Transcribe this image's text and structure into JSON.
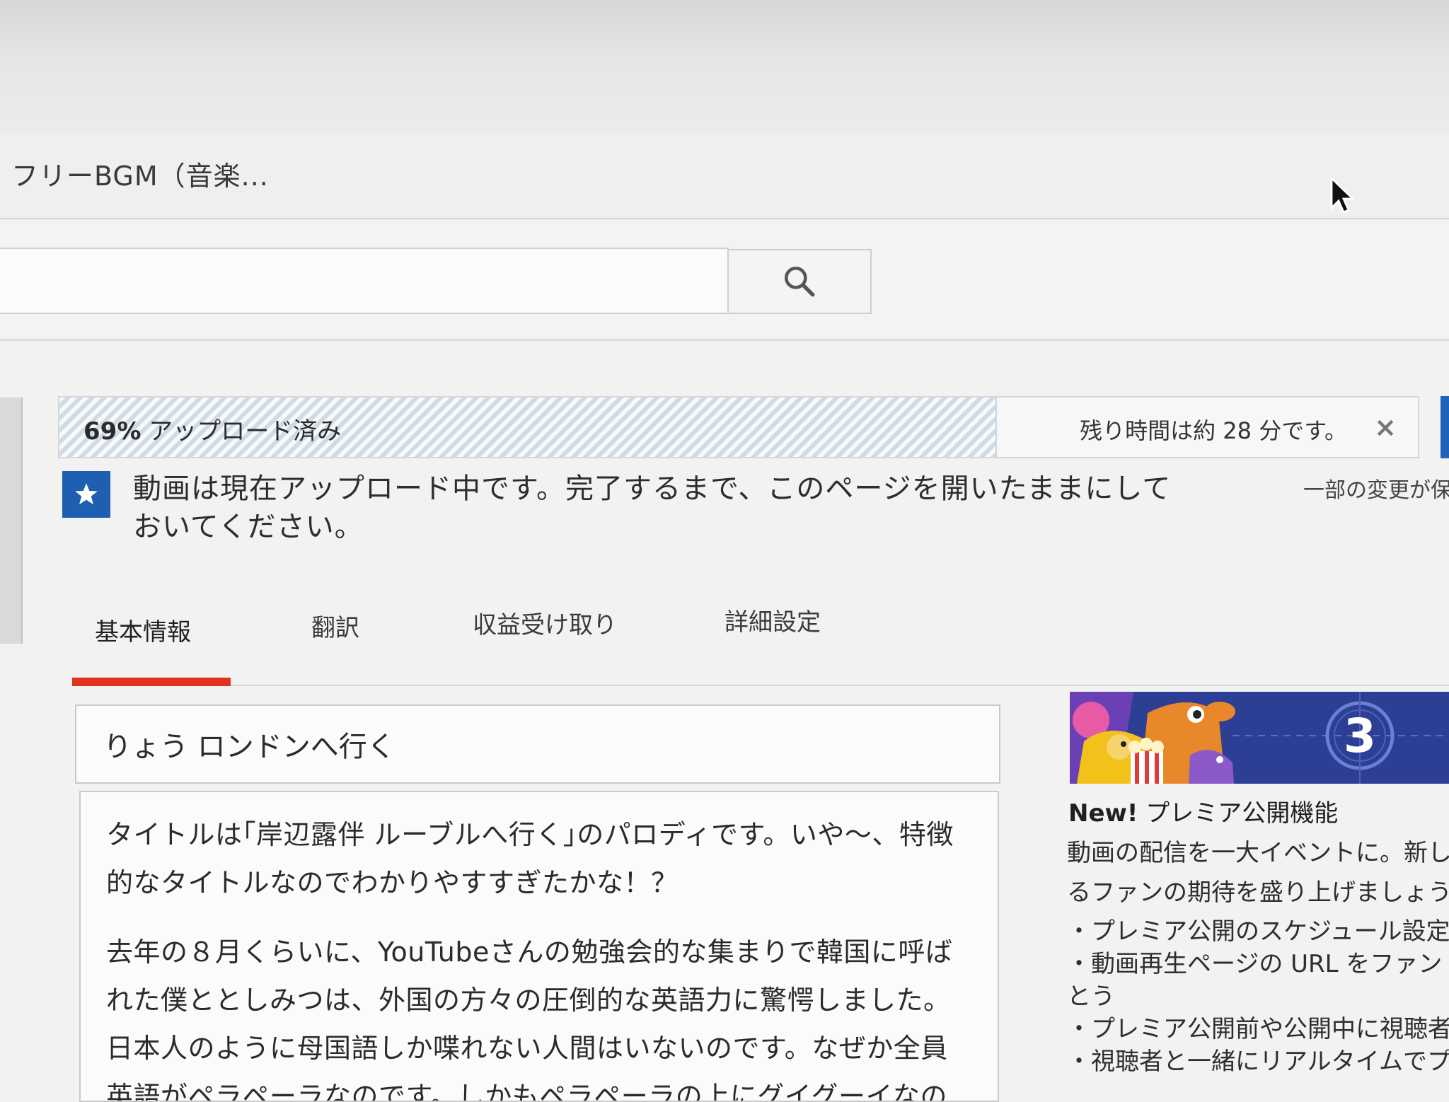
{
  "browser": {
    "tab_title": "フリーBGM（音楽..."
  },
  "search": {
    "value": "",
    "placeholder": ""
  },
  "upload": {
    "progress_percent": 69,
    "progress_value": "69%",
    "progress_text": " アップロード済み",
    "time_remaining": "残り時間は約 28 分です。",
    "close_label": "×"
  },
  "notice": {
    "text": "動画は現在アップロード中です。完了するまで、このページを開いたままにしておいてください。",
    "side_text": "一部の変更が保"
  },
  "tabs": [
    {
      "label": "基本情報",
      "active": true
    },
    {
      "label": "翻訳",
      "active": false
    },
    {
      "label": "収益受け取り",
      "active": false
    },
    {
      "label": "詳細設定",
      "active": false
    }
  ],
  "video": {
    "title": "りょう ロンドンへ行く",
    "description": [
      "タイトルは｢岸辺露伴 ルーブルへ行く｣のパロディです。いや〜、特徴的なタイトルなのでわかりやすすぎたかな！？",
      "去年の８月くらいに、YouTubeさんの勉強会的な集まりで韓国に呼ばれた僕ととしみつは、外国の方々の圧倒的な英語力に驚愕しました。日本人のように母国語しか喋れない人間はいないのです。なぜか全員英語がペラペーラなのです。しかもペラペーラの上にグイグーイなの"
    ]
  },
  "promo": {
    "banner_number": "3",
    "title_new": "New!",
    "title_rest": " プレミア公開機能",
    "body": "動画の配信を一大イベントに。新しるファンの期待を盛り上げましょう",
    "items": [
      "プレミア公開のスケジュール設定",
      "動画再生ページの URL をファンとう",
      "プレミア公開前や公開中に視聴者",
      "視聴者と一緒にリアルタイムでプ"
    ]
  },
  "colors": {
    "accent_red": "#e0321c",
    "notice_blue": "#1f5fb2",
    "promo_blue": "#2d3f94"
  }
}
